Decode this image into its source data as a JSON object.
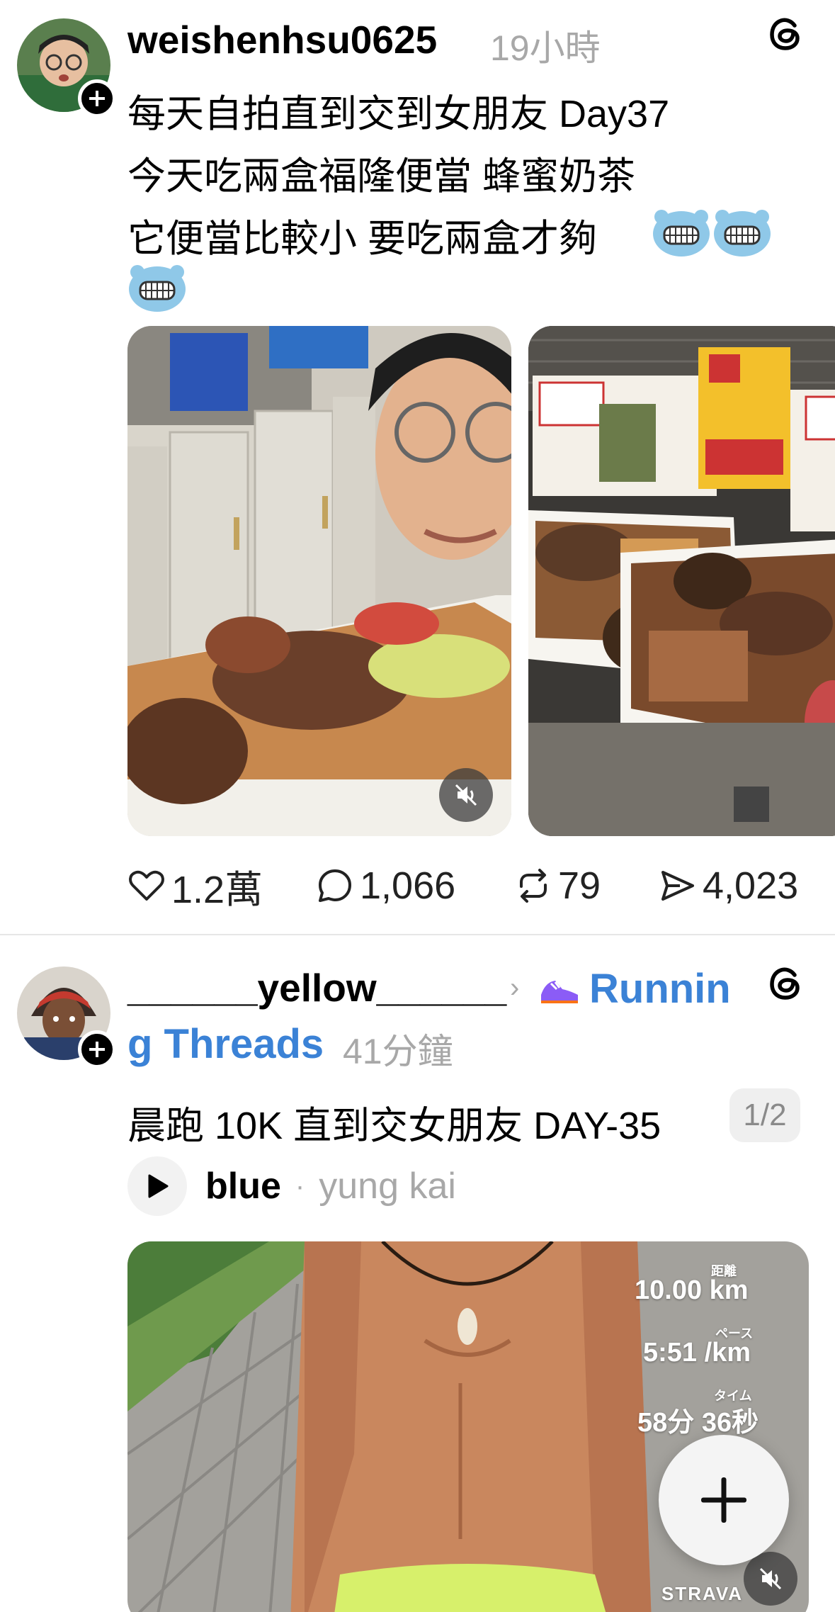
{
  "post1": {
    "username": "weishenhsu0625",
    "time": "19小時",
    "lines": [
      "每天自拍直到交到女朋友 Day37",
      "今天吃兩盒福隆便當 蜂蜜奶茶",
      "它便當比較小 要吃兩盒才夠"
    ],
    "actions": {
      "likes": "1.2萬",
      "comments": "1,066",
      "reposts": "79",
      "shares": "4,023"
    }
  },
  "post2": {
    "username": "______yellow______",
    "community_part1": "Runnin",
    "community_part2": "g Threads",
    "time": "41分鐘",
    "text": "晨跑 10K 直到交女朋友 DAY-35",
    "page_indicator": "1/2",
    "music": {
      "song": "blue",
      "separator": "·",
      "artist": "yung kai"
    },
    "stats": {
      "distance_label": "距離",
      "distance": "10.00 km",
      "pace_label": "ペース",
      "pace": "5:51 /km",
      "time_label": "タイム",
      "time": "58分 36秒",
      "brand": "STRAVA"
    }
  },
  "colors": {
    "accent": "#3b82d6",
    "muted": "#a8a8a8",
    "divider": "#e6e6e6"
  },
  "icons": [
    "threads-icon",
    "heart-icon",
    "comment-icon",
    "repost-icon",
    "share-icon",
    "play-icon",
    "mute-icon",
    "plus-icon"
  ]
}
